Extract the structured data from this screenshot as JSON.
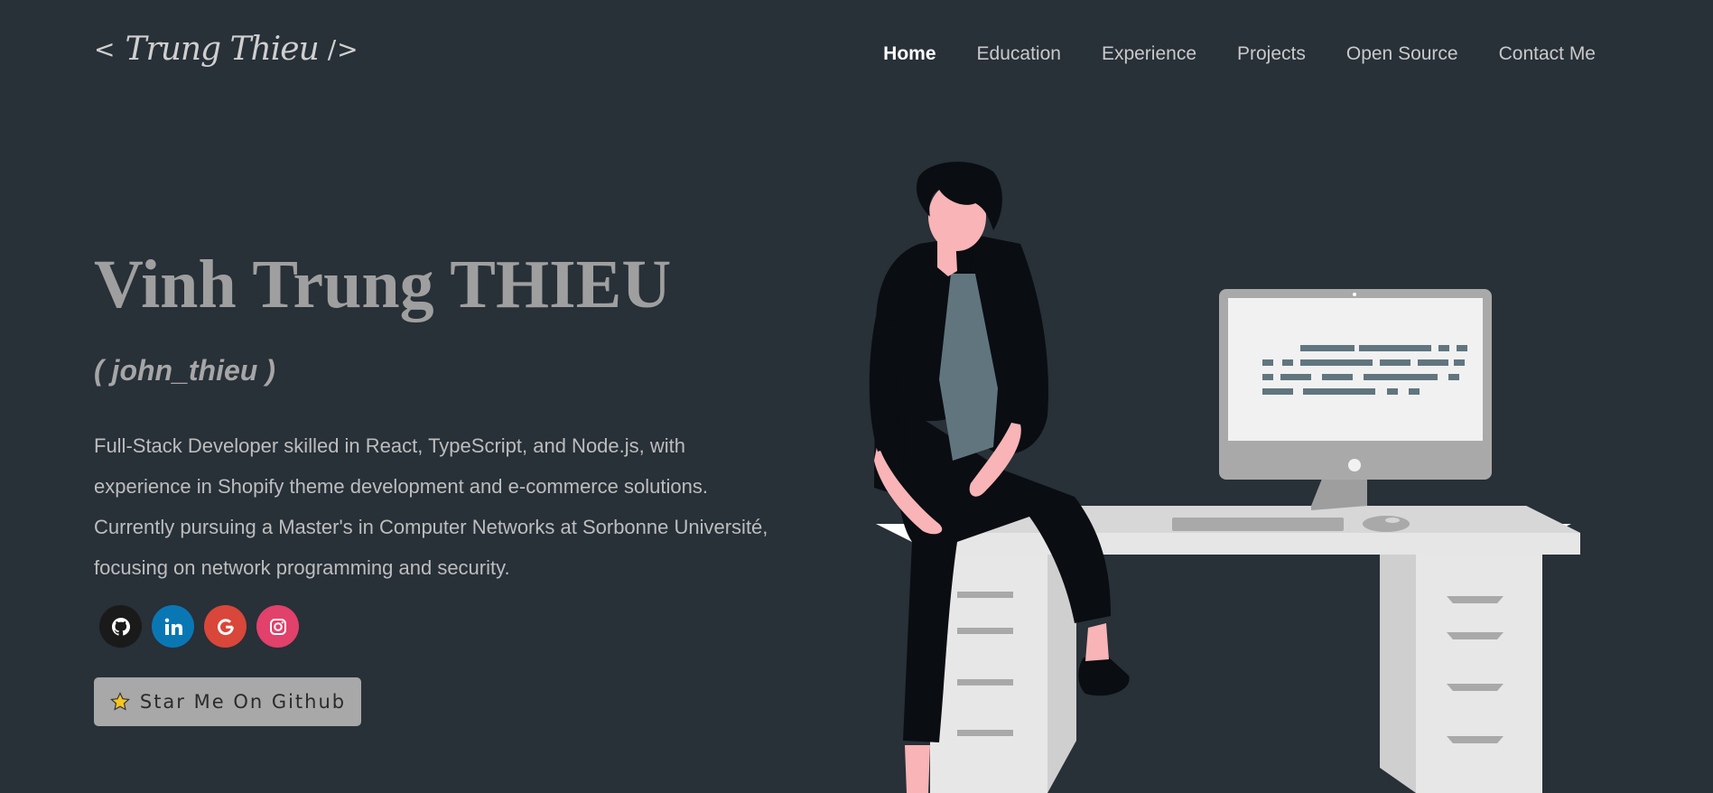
{
  "header": {
    "logo": {
      "open": "<",
      "signature": "Trung Thieu",
      "close": "/>"
    },
    "nav": [
      {
        "label": "Home",
        "active": true
      },
      {
        "label": "Education",
        "active": false
      },
      {
        "label": "Experience",
        "active": false
      },
      {
        "label": "Projects",
        "active": false
      },
      {
        "label": "Open Source",
        "active": false
      },
      {
        "label": "Contact Me",
        "active": false
      }
    ]
  },
  "hero": {
    "name": "Vinh Trung THIEU",
    "handle": "( john_thieu )",
    "bio": "Full-Stack Developer skilled in React, TypeScript, and Node.js, with experience in Shopify theme development and e-commerce solutions. Currently pursuing a Master's in Computer Networks at Sorbonne Université, focusing on network programming and security.",
    "socials": [
      {
        "name": "github",
        "icon": "github-icon",
        "color": "#1a1a1a"
      },
      {
        "name": "linkedin",
        "icon": "linkedin-icon",
        "color": "#0a77b5"
      },
      {
        "name": "google",
        "icon": "google-icon",
        "color": "#d9463a"
      },
      {
        "name": "instagram",
        "icon": "instagram-icon",
        "color": "#e1416b"
      }
    ],
    "star_button": {
      "icon": "star-icon",
      "label": "Star Me On Github"
    }
  },
  "illustration": {
    "icon": "developer-at-desk-illustration"
  }
}
